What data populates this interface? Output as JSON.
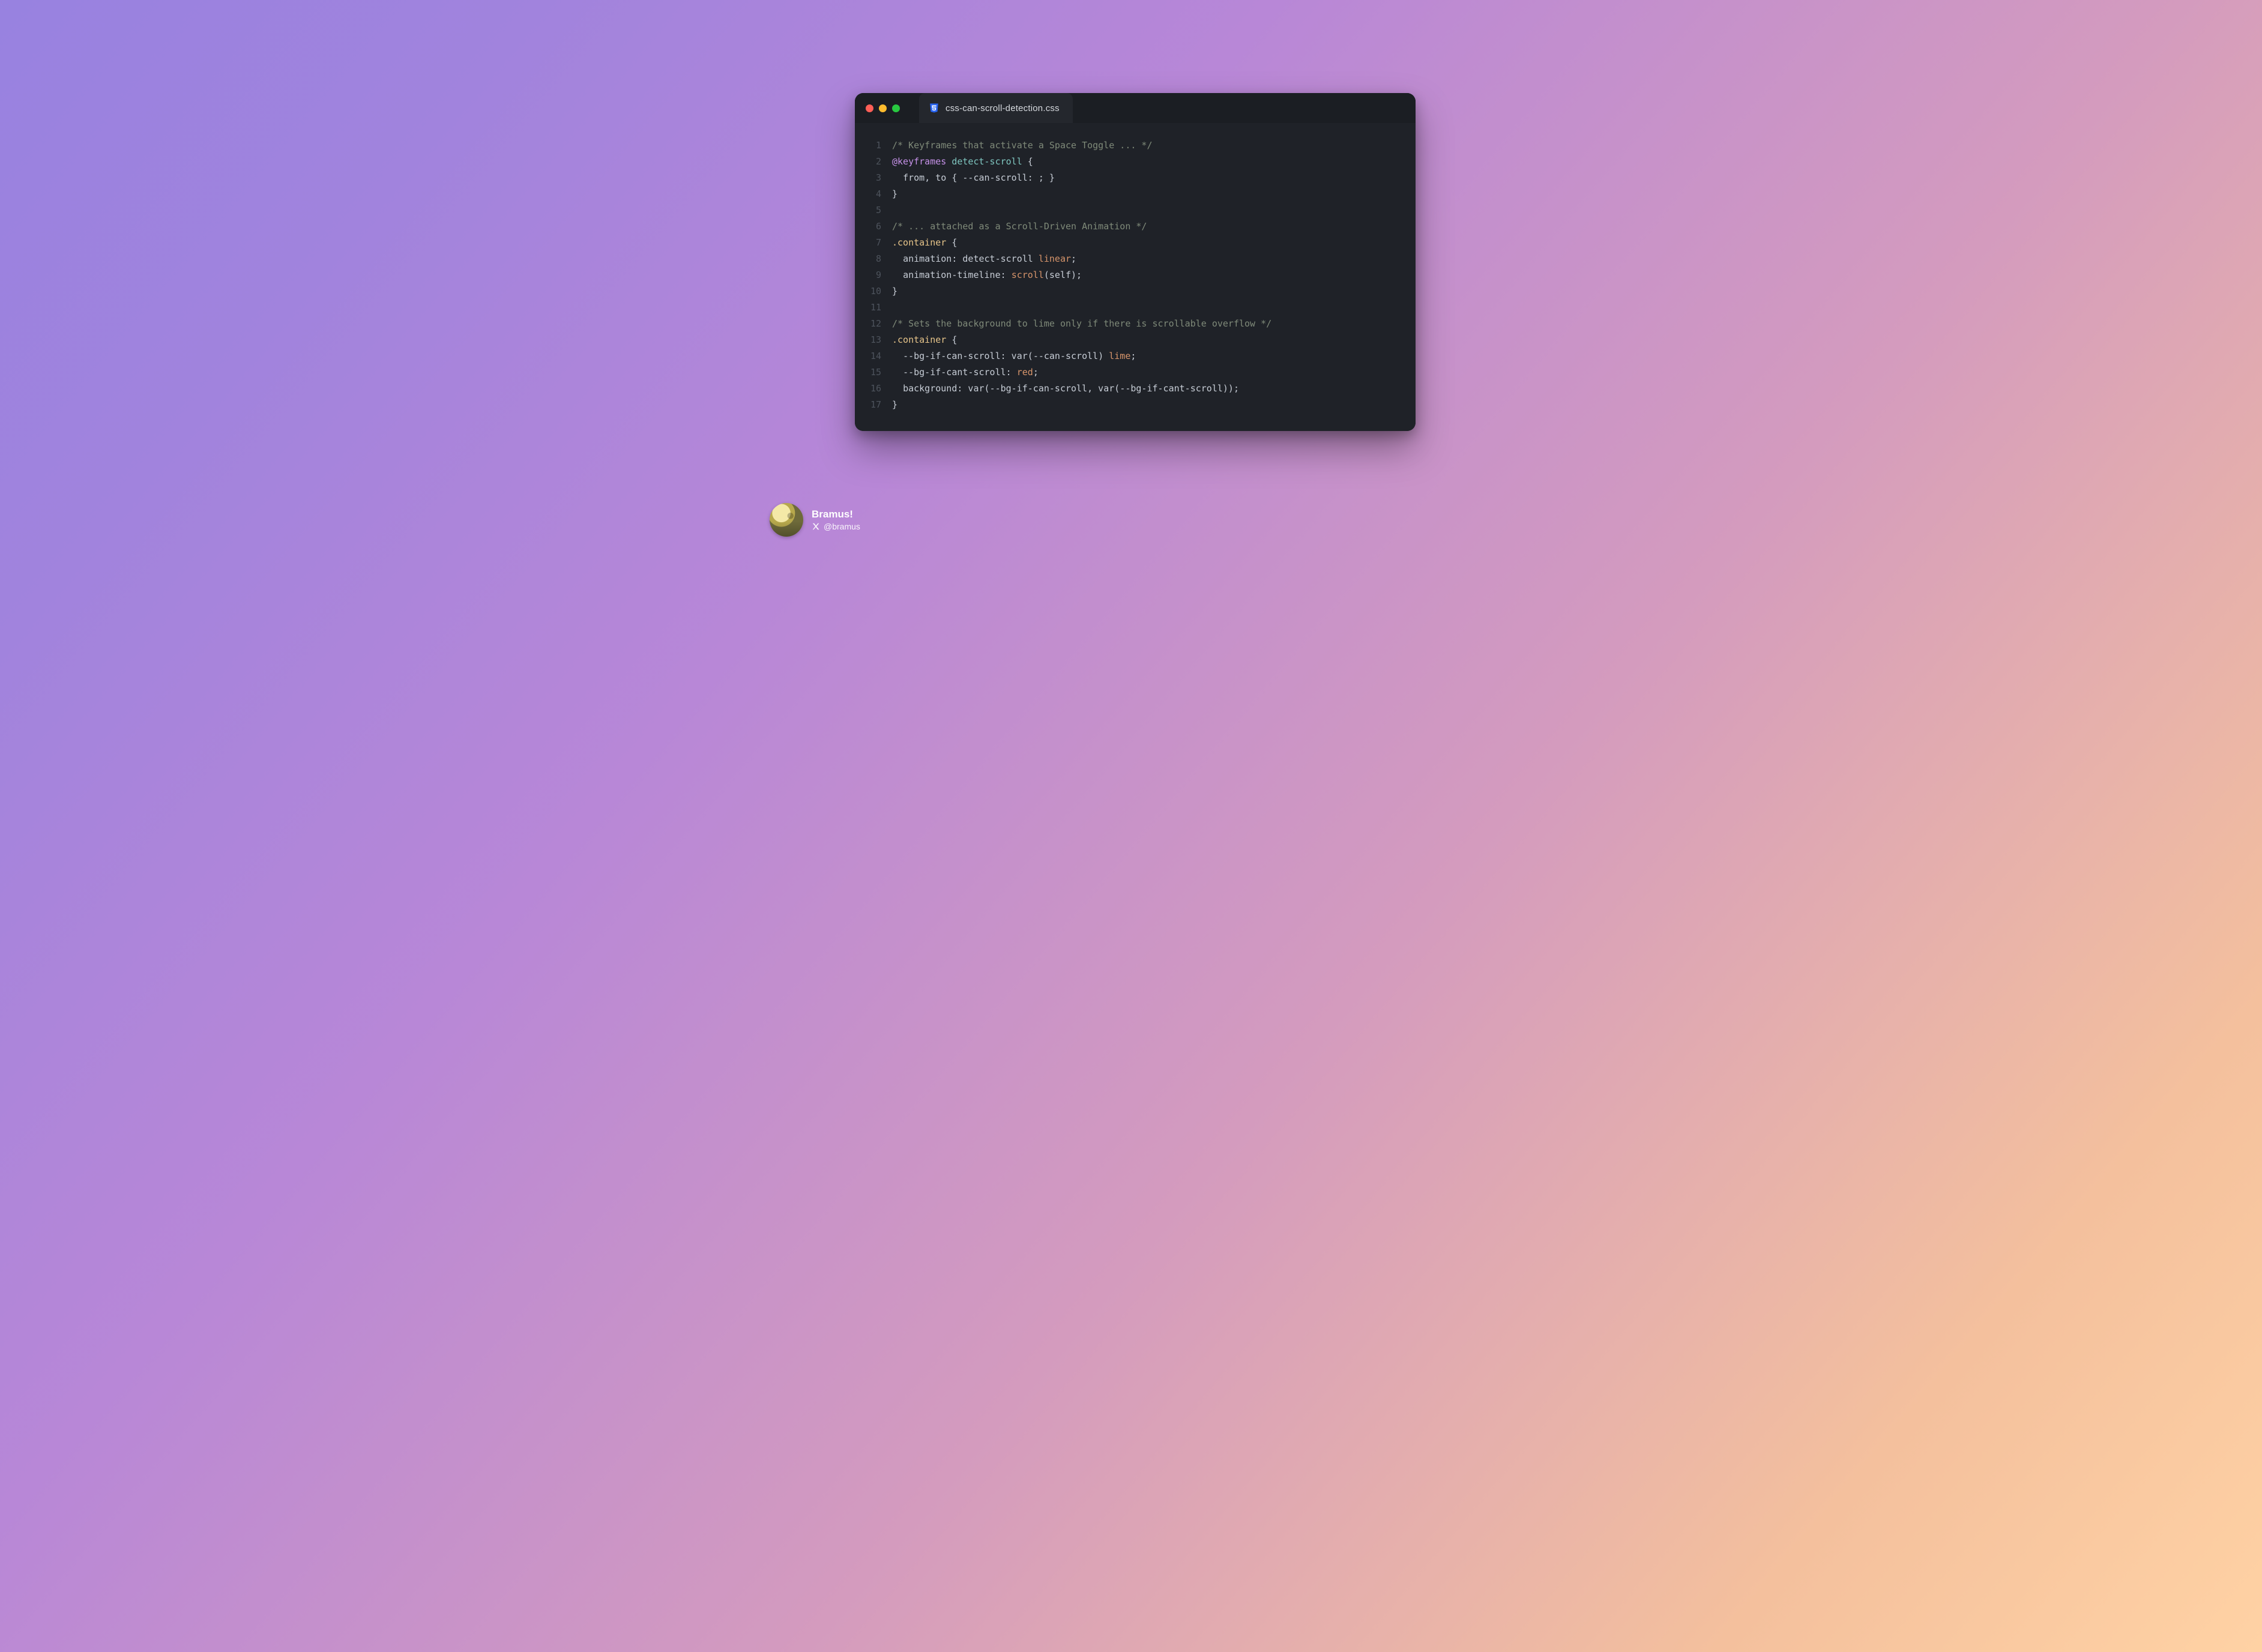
{
  "window": {
    "filename": "css-can-scroll-detection.css",
    "file_icon": "css3-icon"
  },
  "traffic_lights": {
    "red": "#ff5f57",
    "yellow": "#febc2e",
    "green": "#28c840"
  },
  "code": {
    "lines": [
      {
        "n": "1",
        "tokens": [
          {
            "t": "/* Keyframes that activate a Space Toggle ... */",
            "c": "tok-comment"
          }
        ]
      },
      {
        "n": "2",
        "tokens": [
          {
            "t": "@keyframes",
            "c": "tok-at"
          },
          {
            "t": " ",
            "c": "tok-punc"
          },
          {
            "t": "detect-scroll",
            "c": "tok-ident"
          },
          {
            "t": " {",
            "c": "tok-punc"
          }
        ]
      },
      {
        "n": "3",
        "tokens": [
          {
            "t": "  ",
            "c": "tok-punc"
          },
          {
            "t": "from",
            "c": "tok-key"
          },
          {
            "t": ", ",
            "c": "tok-punc"
          },
          {
            "t": "to",
            "c": "tok-key"
          },
          {
            "t": " { ",
            "c": "tok-punc"
          },
          {
            "t": "--can-scroll",
            "c": "tok-var"
          },
          {
            "t": ": ; }",
            "c": "tok-punc"
          }
        ]
      },
      {
        "n": "4",
        "tokens": [
          {
            "t": "}",
            "c": "tok-punc"
          }
        ]
      },
      {
        "n": "5",
        "tokens": [
          {
            "t": "",
            "c": "tok-punc"
          }
        ]
      },
      {
        "n": "6",
        "tokens": [
          {
            "t": "/* ... attached as a Scroll-Driven Animation */",
            "c": "tok-comment"
          }
        ]
      },
      {
        "n": "7",
        "tokens": [
          {
            "t": ".container",
            "c": "tok-sel"
          },
          {
            "t": " {",
            "c": "tok-punc"
          }
        ]
      },
      {
        "n": "8",
        "tokens": [
          {
            "t": "  ",
            "c": "tok-punc"
          },
          {
            "t": "animation",
            "c": "tok-prop"
          },
          {
            "t": ": detect-scroll ",
            "c": "tok-punc"
          },
          {
            "t": "linear",
            "c": "tok-builtin"
          },
          {
            "t": ";",
            "c": "tok-punc"
          }
        ]
      },
      {
        "n": "9",
        "tokens": [
          {
            "t": "  ",
            "c": "tok-punc"
          },
          {
            "t": "animation-timeline",
            "c": "tok-prop"
          },
          {
            "t": ": ",
            "c": "tok-punc"
          },
          {
            "t": "scroll",
            "c": "tok-builtin"
          },
          {
            "t": "(self);",
            "c": "tok-punc"
          }
        ]
      },
      {
        "n": "10",
        "tokens": [
          {
            "t": "}",
            "c": "tok-punc"
          }
        ]
      },
      {
        "n": "11",
        "tokens": [
          {
            "t": "",
            "c": "tok-punc"
          }
        ]
      },
      {
        "n": "12",
        "tokens": [
          {
            "t": "/* Sets the background to lime only if there is scrollable overflow */",
            "c": "tok-comment"
          }
        ]
      },
      {
        "n": "13",
        "tokens": [
          {
            "t": ".container",
            "c": "tok-sel"
          },
          {
            "t": " {",
            "c": "tok-punc"
          }
        ]
      },
      {
        "n": "14",
        "tokens": [
          {
            "t": "  ",
            "c": "tok-punc"
          },
          {
            "t": "--bg-if-can-scroll",
            "c": "tok-var"
          },
          {
            "t": ": var(",
            "c": "tok-punc"
          },
          {
            "t": "--can-scroll",
            "c": "tok-var"
          },
          {
            "t": ") ",
            "c": "tok-punc"
          },
          {
            "t": "lime",
            "c": "tok-builtin"
          },
          {
            "t": ";",
            "c": "tok-punc"
          }
        ]
      },
      {
        "n": "15",
        "tokens": [
          {
            "t": "  ",
            "c": "tok-punc"
          },
          {
            "t": "--bg-if-cant-scroll",
            "c": "tok-var"
          },
          {
            "t": ": ",
            "c": "tok-punc"
          },
          {
            "t": "red",
            "c": "tok-redkw"
          },
          {
            "t": ";",
            "c": "tok-punc"
          }
        ]
      },
      {
        "n": "16",
        "tokens": [
          {
            "t": "  ",
            "c": "tok-punc"
          },
          {
            "t": "background",
            "c": "tok-prop"
          },
          {
            "t": ": var(",
            "c": "tok-punc"
          },
          {
            "t": "--bg-if-can-scroll",
            "c": "tok-var"
          },
          {
            "t": ", var(",
            "c": "tok-punc"
          },
          {
            "t": "--bg-if-cant-scroll",
            "c": "tok-var"
          },
          {
            "t": "));",
            "c": "tok-punc"
          }
        ]
      },
      {
        "n": "17",
        "tokens": [
          {
            "t": "}",
            "c": "tok-punc"
          }
        ]
      }
    ]
  },
  "author": {
    "name": "Bramus!",
    "handle": "@bramus",
    "platform_icon": "x-icon"
  }
}
